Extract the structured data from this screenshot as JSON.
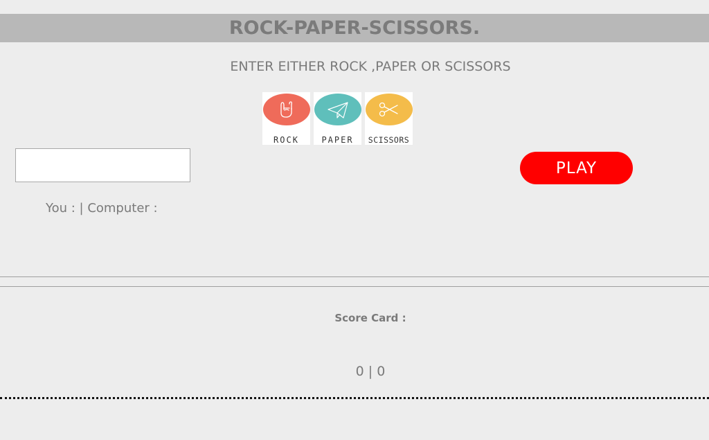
{
  "header": {
    "title": "ROCK-PAPER-SCISSORS."
  },
  "instruction": "ENTER EITHER ROCK ,PAPER OR SCISSORS",
  "choices": [
    {
      "label": "ROCK",
      "icon": "rock-hand-icon",
      "color": "#ef6b5a"
    },
    {
      "label": "PAPER",
      "icon": "paper-plane-icon",
      "color": "#5fbfbb"
    },
    {
      "label": "SCISSORS",
      "icon": "scissors-icon",
      "color": "#f4bc4a"
    }
  ],
  "move_input": {
    "value": "",
    "placeholder": ""
  },
  "play_button": {
    "label": "PLAY",
    "color": "#ff0000"
  },
  "result": {
    "text": "You : | Computer :"
  },
  "score_card": {
    "title": "Score Card :",
    "value": "0 | 0"
  }
}
